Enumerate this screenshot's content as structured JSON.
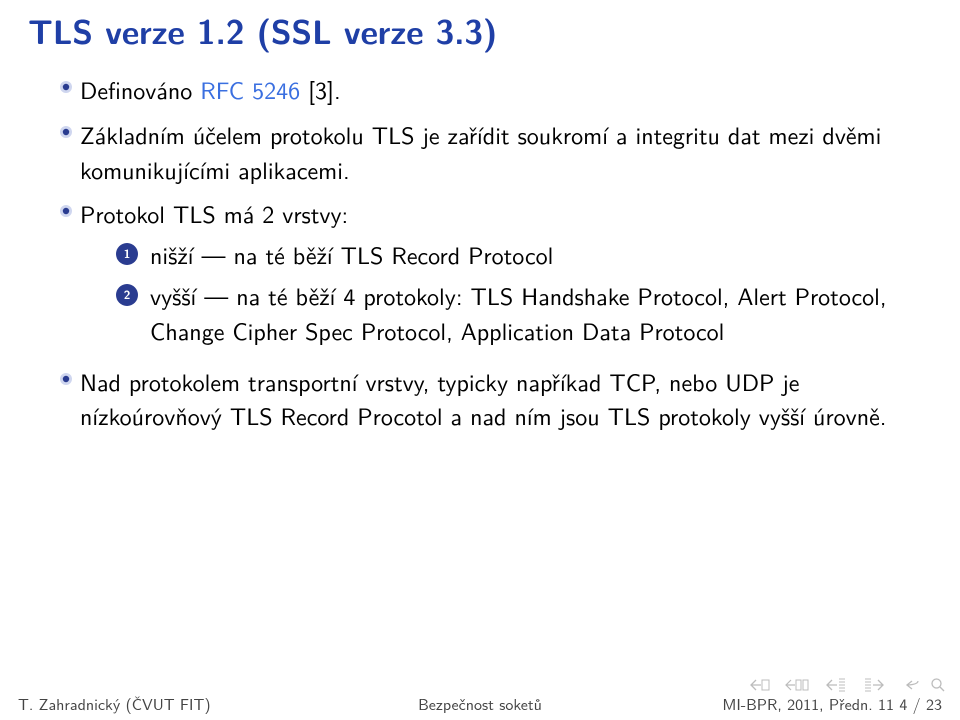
{
  "title": "TLS verze 1.2 (SSL verze 3.3)",
  "bullets": [
    {
      "pre": "Definováno ",
      "link": "RFC 5246",
      "post": " [3]."
    },
    {
      "text": "Základním účelem protokolu TLS je zařídit soukromí a integritu dat mezi dvěmi komunikujícími aplikacemi."
    },
    {
      "text": "Protokol TLS má 2 vrstvy:",
      "sub": [
        {
          "n": "1",
          "text": "nišží — na té běží TLS Record Protocol"
        },
        {
          "n": "2",
          "text": "vyšší — na té běží 4 protokoly: TLS Handshake Protocol, Alert Protocol, Change Cipher Spec Protocol, Application Data Protocol"
        }
      ]
    },
    {
      "text": "Nad protokolem transportní vrstvy, typicky napříkad TCP, nebo UDP je nízkoúrovňový TLS Record Procotol a nad ním jsou TLS protokoly vyšší úrovně."
    }
  ],
  "footer": {
    "left": "T. Zahradnický (ČVUT FIT)",
    "center": "Bezpečnost soketů",
    "right": "MI-BPR, 2011, Předn. 11    4 / 23"
  }
}
